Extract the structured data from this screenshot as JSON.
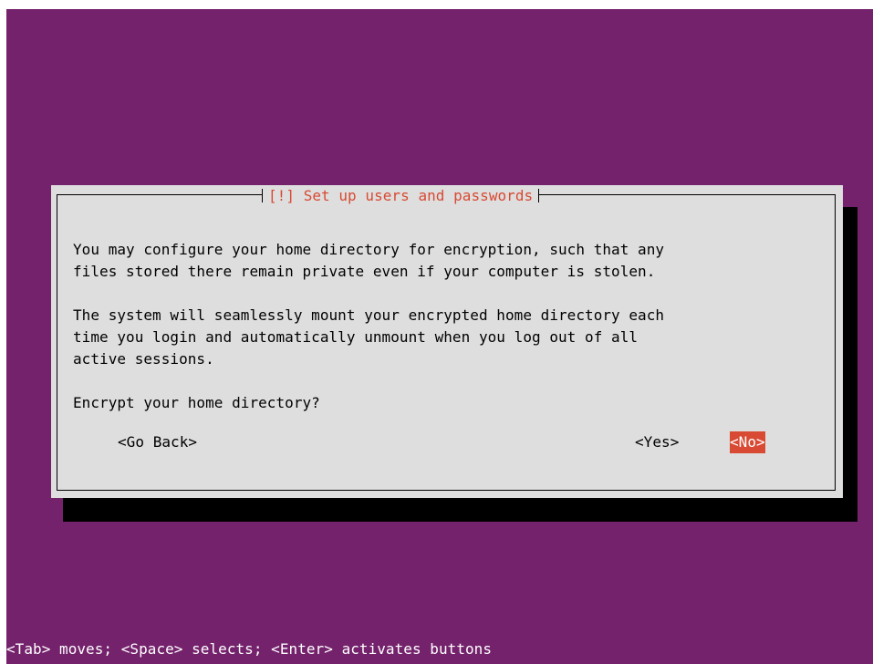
{
  "dialog": {
    "title": "[!] Set up users and passwords",
    "paragraph1": [
      "You may configure your home directory for encryption, such that any",
      "files stored there remain private even if your computer is stolen."
    ],
    "paragraph2": [
      "The system will seamlessly mount your encrypted home directory each",
      "time you login and automatically unmount when you log out of all",
      "active sessions."
    ],
    "question": "Encrypt your home directory?",
    "buttons": {
      "go_back": "<Go Back>",
      "yes": "<Yes>",
      "no": "<No>"
    },
    "selected_button": "no"
  },
  "status_bar": "<Tab> moves; <Space> selects; <Enter> activates buttons",
  "colors": {
    "background": "#74226c",
    "dialog": "#dedede",
    "accent": "#d84a33",
    "shadow": "#000000"
  }
}
